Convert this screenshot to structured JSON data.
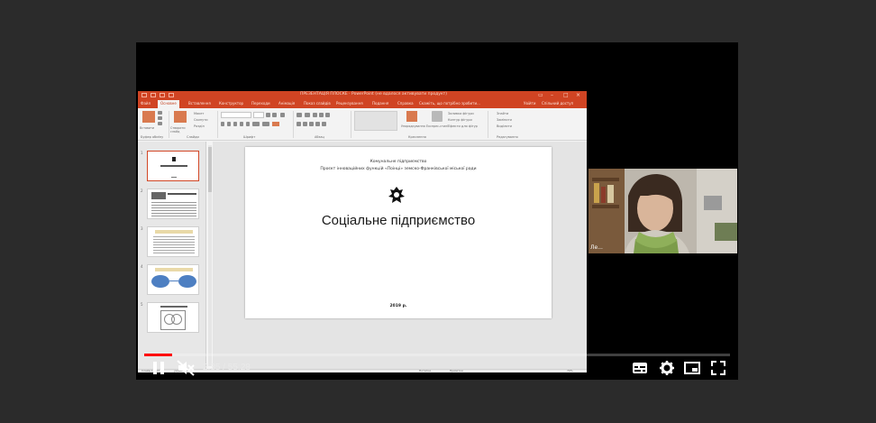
{
  "ppt": {
    "title": "ПРЕЗЕНТАЦІЯ ПЛОСКЕ · PowerPoint (не вдалося активувати продукт)",
    "tabs": [
      "Файл",
      "Основне",
      "Вставлення",
      "Конструктор",
      "Переходи",
      "Анімація",
      "Показ слайдів",
      "Рецензування",
      "Подання",
      "Справка",
      "Скажіть, що потрібно зробити..."
    ],
    "account": "Увійти",
    "share": "Спільний доступ",
    "ribbon_groups": [
      "Буфер обміну",
      "Слайди",
      "Шрифт",
      "Абзац",
      "Креслення",
      "Редагування"
    ],
    "buttons": {
      "paste": "Вставити",
      "new_slide": "Створити слайд",
      "layout": "Макет",
      "reset": "Скинути",
      "section": "Розділ",
      "arrange": "Упорядкування",
      "quick_styles": "Експрес-стилі",
      "shape_fill": "Заливка фігури",
      "shape_outline": "Контур фігури",
      "shape_effects": "Ефекти для фігур",
      "find": "Знайти",
      "replace": "Замінити",
      "select": "Виділити"
    },
    "slide_numbers": [
      "1",
      "2",
      "3",
      "4",
      "5"
    ],
    "slide": {
      "org": "Комунальне підприємство",
      "program": "Проєкт інноваційних функцій «Поінці» земско-Франківської міської ради",
      "title": "Соціальне підприємство",
      "year": "2019 р."
    },
    "status_left": "Слайд 1 з 13",
    "status_lang": "українська",
    "status_notes": "Нотатки",
    "status_comments": "Примітки",
    "zoom": "70%"
  },
  "webcam": {
    "name": "Ле..."
  },
  "player": {
    "time": "2:35 / 55:28",
    "progress_fraction": 0.047,
    "accent": "#ff0000"
  },
  "icons": {
    "play_pause": "pause-icon",
    "volume": "volume-muted-icon",
    "subtitles": "subtitles-icon",
    "settings": "gear-icon",
    "miniplayer": "miniplayer-icon",
    "fullscreen": "fullscreen-icon"
  }
}
